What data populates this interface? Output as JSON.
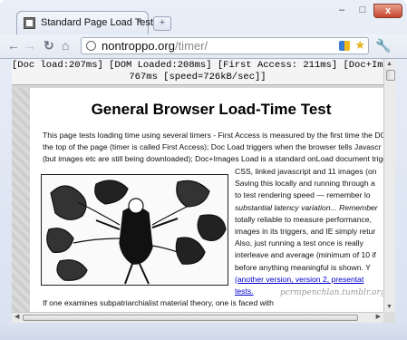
{
  "tab": {
    "title": "Standard Page Load Test",
    "close": "×"
  },
  "newtab": {
    "label": "+"
  },
  "window_controls": {
    "minimize": "–",
    "maximize": "□",
    "close": "x"
  },
  "omnibox": {
    "host": "nontroppo.org",
    "path": "/timer/"
  },
  "timer": {
    "line1": "[Doc load:207ms] [DOM Loaded:208ms] [First Access: 211ms] [Doc+Image Load:",
    "line2": "767ms [speed=726kB/sec]]"
  },
  "page": {
    "title": "General Browser Load-Time Test",
    "para_lines": [
      "This page tests loading time using several timers - First Access is measured by the first time the DOM",
      "the top of the page (timer is called First Access); Doc Load triggers when the browser tells Javascr",
      "(but images etc are still being downloaded); Doc+Images Load is a standard onLoad document trigge"
    ],
    "right_lines": [
      "CSS, linked javascript and 11 images (on",
      "Saving this locally and running through a",
      "to test rendering speed — remember lo",
      "substantial latency variation... Remember",
      "totally reliable to measure performance,",
      "images in its triggers, and IE simply retur",
      "Also, just running a test once is really",
      "interleave and average (minimum of 10 if",
      "before anything meaningful is shown. Y",
      "(another version, version 2, presentat",
      "tests."
    ],
    "bottom_text": "If one examines subpatriarchialist material theory, one is faced with",
    "watermark": "pcrmpenchlan.tumblr.org"
  },
  "colors": {
    "link": "#0000cc",
    "star": "#e3b21b",
    "close_button": "#c6452d"
  }
}
